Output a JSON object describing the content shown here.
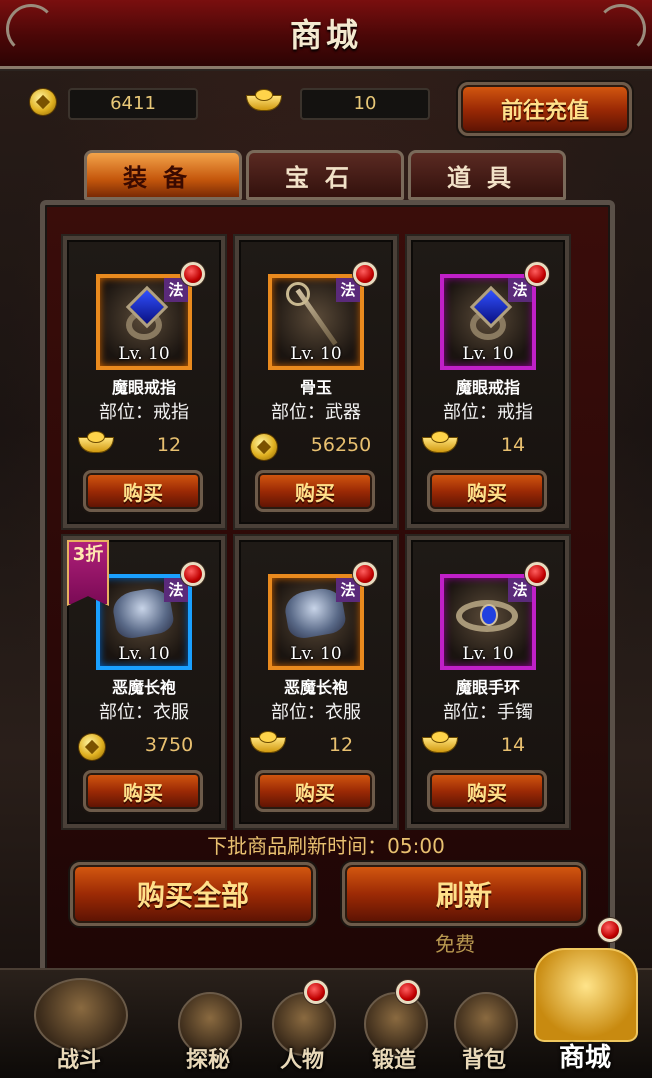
{
  "title": "商城",
  "currency": {
    "coins": "6411",
    "ingots": "10",
    "recharge_label": "前往充值"
  },
  "tabs": [
    {
      "label": "装备",
      "active": true
    },
    {
      "label": "宝石",
      "active": false
    },
    {
      "label": "道具",
      "active": false
    }
  ],
  "items": [
    {
      "name": "魔眼戒指",
      "slot": "部位：戒指",
      "level": "Lv. 10",
      "class_badge": "法",
      "price": "12",
      "currency": "ingot",
      "frame": "orange",
      "icon": "ring-icon",
      "buy_label": "购买",
      "discount": ""
    },
    {
      "name": "骨玉",
      "slot": "部位：武器",
      "level": "Lv. 10",
      "class_badge": "法",
      "price": "56250",
      "currency": "coin",
      "frame": "orange",
      "icon": "staff-icon",
      "buy_label": "购买",
      "discount": ""
    },
    {
      "name": "魔眼戒指",
      "slot": "部位：戒指",
      "level": "Lv. 10",
      "class_badge": "法",
      "price": "14",
      "currency": "ingot",
      "frame": "purple",
      "icon": "ring-icon",
      "buy_label": "购买",
      "discount": ""
    },
    {
      "name": "恶魔长袍",
      "slot": "部位：衣服",
      "level": "Lv. 10",
      "class_badge": "法",
      "price": "3750",
      "currency": "coin",
      "frame": "blue",
      "icon": "robe-icon",
      "buy_label": "购买",
      "discount": "3折"
    },
    {
      "name": "恶魔长袍",
      "slot": "部位：衣服",
      "level": "Lv. 10",
      "class_badge": "法",
      "price": "12",
      "currency": "ingot",
      "frame": "orange",
      "icon": "robe-icon",
      "buy_label": "购买",
      "discount": ""
    },
    {
      "name": "魔眼手环",
      "slot": "部位：手镯",
      "level": "Lv. 10",
      "class_badge": "法",
      "price": "14",
      "currency": "ingot",
      "frame": "purple",
      "icon": "bracelet-icon",
      "buy_label": "购买",
      "discount": ""
    }
  ],
  "refresh_time_text": "下批商品刷新时间：05:00",
  "buy_all_label": "购买全部",
  "refresh_label": "刷新",
  "refresh_cost": "免费",
  "nav": [
    {
      "label": "战斗",
      "badge": false,
      "active": false
    },
    {
      "label": "探秘",
      "badge": false,
      "active": false
    },
    {
      "label": "人物",
      "badge": true,
      "active": false
    },
    {
      "label": "锻造",
      "badge": true,
      "active": false
    },
    {
      "label": "背包",
      "badge": false,
      "active": false
    },
    {
      "label": "商城",
      "badge": true,
      "active": true
    }
  ],
  "colors": {
    "frame_orange": "#e98a1e",
    "frame_purple": "#c020c8",
    "frame_blue": "#1aa0ff",
    "accent_gold": "#e8c070"
  }
}
